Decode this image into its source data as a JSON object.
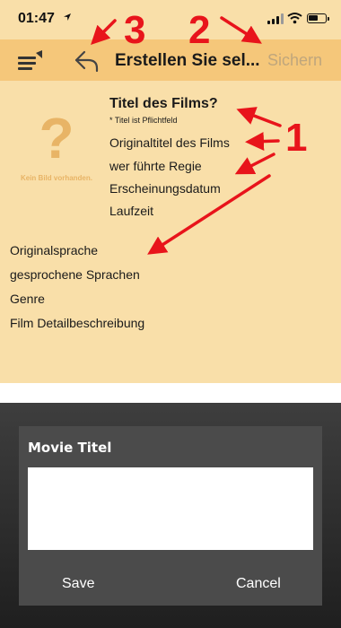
{
  "status": {
    "time": "01:47",
    "location_icon": "location-arrow-icon",
    "battery_level": 0.6
  },
  "nav": {
    "title": "Erstellen Sie sel...",
    "save_label": "Sichern",
    "menu_icon": "menu-list-icon",
    "back_icon": "back-arrow-icon"
  },
  "poster": {
    "placeholder_symbol": "?",
    "placeholder_label": "Kein Bild vorhanden."
  },
  "fields": {
    "title": "Titel des Films?",
    "title_note": "* Titel ist Pflichtfeld",
    "original_title": "Originaltitel des Films",
    "director": "wer führte Regie",
    "release_date": "Erscheinungsdatum",
    "runtime": "Laufzeit",
    "original_language": "Originalsprache",
    "spoken_languages": "gesprochene Sprachen",
    "genre": "Genre",
    "description": "Film Detailbeschreibung"
  },
  "dialog": {
    "title": "Movie Titel",
    "input_value": "",
    "save_label": "Save",
    "cancel_label": "Cancel"
  },
  "annotations": {
    "label_1": "1",
    "label_2": "2",
    "label_3": "3",
    "color": "#e8141b"
  },
  "colors": {
    "background": "#f9dfa9",
    "navbar": "#f5c77a",
    "placeholder": "#e8b466",
    "save_disabled": "#bfa67c",
    "dialog": "#4b4b4b"
  }
}
